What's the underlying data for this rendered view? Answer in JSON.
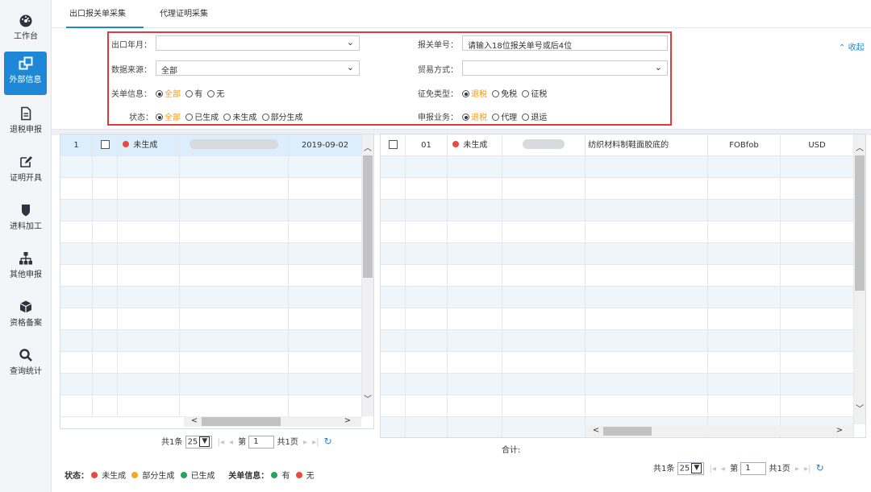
{
  "sidebar": {
    "items": [
      {
        "label": "工作台",
        "icon": "dashboard-icon"
      },
      {
        "label": "外部信息",
        "icon": "external-info-icon"
      },
      {
        "label": "退税申报",
        "icon": "document-icon"
      },
      {
        "label": "证明开具",
        "icon": "edit-icon"
      },
      {
        "label": "进料加工",
        "icon": "shield-icon"
      },
      {
        "label": "其他申报",
        "icon": "sitemap-icon"
      },
      {
        "label": "资格备案",
        "icon": "cube-icon"
      },
      {
        "label": "查询统计",
        "icon": "search-icon"
      }
    ]
  },
  "tabs": [
    "出口报关单采集",
    "代理证明采集"
  ],
  "filters": {
    "export_month_label": "出口年月：",
    "export_month_value": "",
    "data_source_label": "数据来源：",
    "data_source_value": "全部",
    "customs_info_label": "关单信息：",
    "customs_info_options": [
      "全部",
      "有",
      "无"
    ],
    "status_label": "状态：",
    "status_options": [
      "全部",
      "已生成",
      "未生成",
      "部分生成"
    ],
    "declaration_no_label": "报关单号：",
    "declaration_no_placeholder": "请输入18位报关单号或后4位",
    "trade_mode_label": "贸易方式：",
    "trade_mode_value": "",
    "tax_type_label": "征免类型：",
    "tax_type_options": [
      "退税",
      "免税",
      "征税"
    ],
    "business_label": "申报业务：",
    "business_options": [
      "退税",
      "代理",
      "退运"
    ],
    "collapse_label": "收起"
  },
  "left_table": {
    "rows": [
      {
        "index": "1",
        "status": "未生成",
        "date": "2019-09-02"
      }
    ],
    "pager": {
      "total": "共1条",
      "page_size": "25",
      "page_prefix": "第",
      "page": "1",
      "pages": "共1页"
    }
  },
  "right_table": {
    "rows": [
      {
        "seq": "01",
        "status": "未生成",
        "goods": "纺织材料制鞋面胶底的",
        "terms": "FOBfob",
        "currency": "USD"
      }
    ],
    "total_label": "合计:",
    "pager": {
      "total": "共1条",
      "page_size": "25",
      "page_prefix": "第",
      "page": "1",
      "pages": "共1页"
    }
  },
  "legend": {
    "status_label": "状态：",
    "status_items": [
      {
        "label": "未生成",
        "color": "#e84b3c"
      },
      {
        "label": "部分生成",
        "color": "#f5a623"
      },
      {
        "label": "已生成",
        "color": "#21a65a"
      }
    ],
    "customs_label": "关单信息：",
    "customs_items": [
      {
        "label": "有",
        "color": "#21a65a"
      },
      {
        "label": "无",
        "color": "#e84b3c"
      }
    ]
  },
  "colors": {
    "accent": "#1e88d6",
    "highlight_border": "#e23a3a",
    "selected_option": "#f39a1e"
  }
}
